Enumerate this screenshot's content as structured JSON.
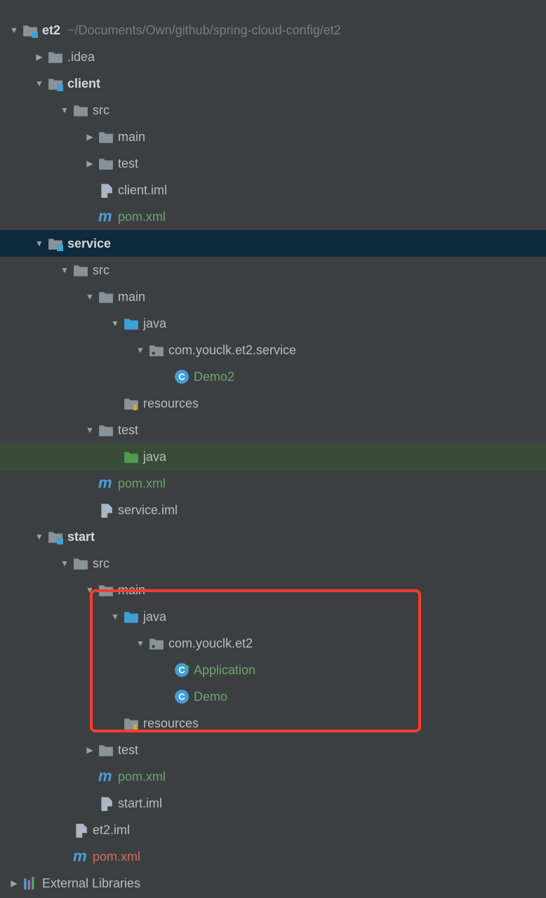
{
  "root": {
    "name": "et2",
    "path": "~/Documents/Own/github/spring-cloud-config/et2"
  },
  "nodes": {
    "idea": ".idea",
    "client": "client",
    "client_src": "src",
    "client_main": "main",
    "client_test": "test",
    "client_iml": "client.iml",
    "client_pom": "pom.xml",
    "service": "service",
    "service_src": "src",
    "service_main": "main",
    "service_java": "java",
    "service_pkg": "com.youclk.et2.service",
    "service_demo2": "Demo2",
    "service_resources": "resources",
    "service_test": "test",
    "service_test_java": "java",
    "service_pom": "pom.xml",
    "service_iml": "service.iml",
    "start": "start",
    "start_src": "src",
    "start_main": "main",
    "start_java": "java",
    "start_pkg": "com.youclk.et2",
    "start_app": "Application",
    "start_demo": "Demo",
    "start_resources": "resources",
    "start_test": "test",
    "start_pom": "pom.xml",
    "start_iml": "start.iml",
    "et2_iml": "et2.iml",
    "root_pom": "pom.xml",
    "ext_lib": "External Libraries"
  }
}
